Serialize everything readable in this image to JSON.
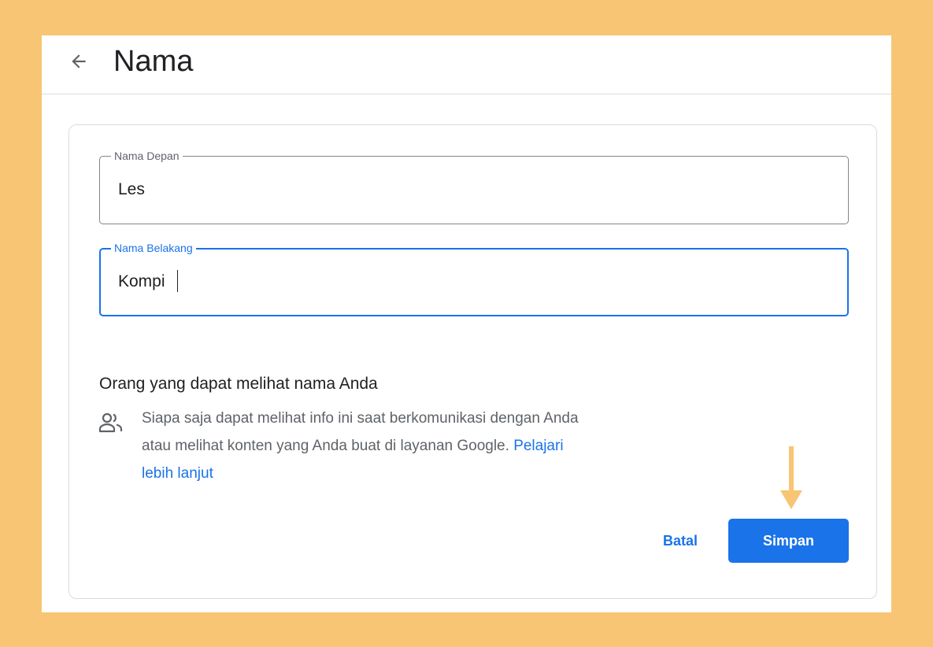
{
  "colors": {
    "background": "#f7c574",
    "accent": "#1a73e8",
    "annotation_arrow": "#f7c574"
  },
  "header": {
    "back_icon": "arrow-back-icon",
    "title": "Nama"
  },
  "form": {
    "first_name": {
      "label": "Nama Depan",
      "value": "Les"
    },
    "last_name": {
      "label": "Nama Belakang",
      "value": "Kompi"
    }
  },
  "visibility": {
    "heading": "Orang yang dapat melihat nama Anda",
    "icon": "people-icon",
    "text": "Siapa saja dapat melihat info ini saat berkomunikasi dengan Anda atau melihat konten yang Anda buat di layanan Google.",
    "link": "Pelajari lebih lanjut"
  },
  "actions": {
    "cancel_label": "Batal",
    "save_label": "Simpan"
  }
}
